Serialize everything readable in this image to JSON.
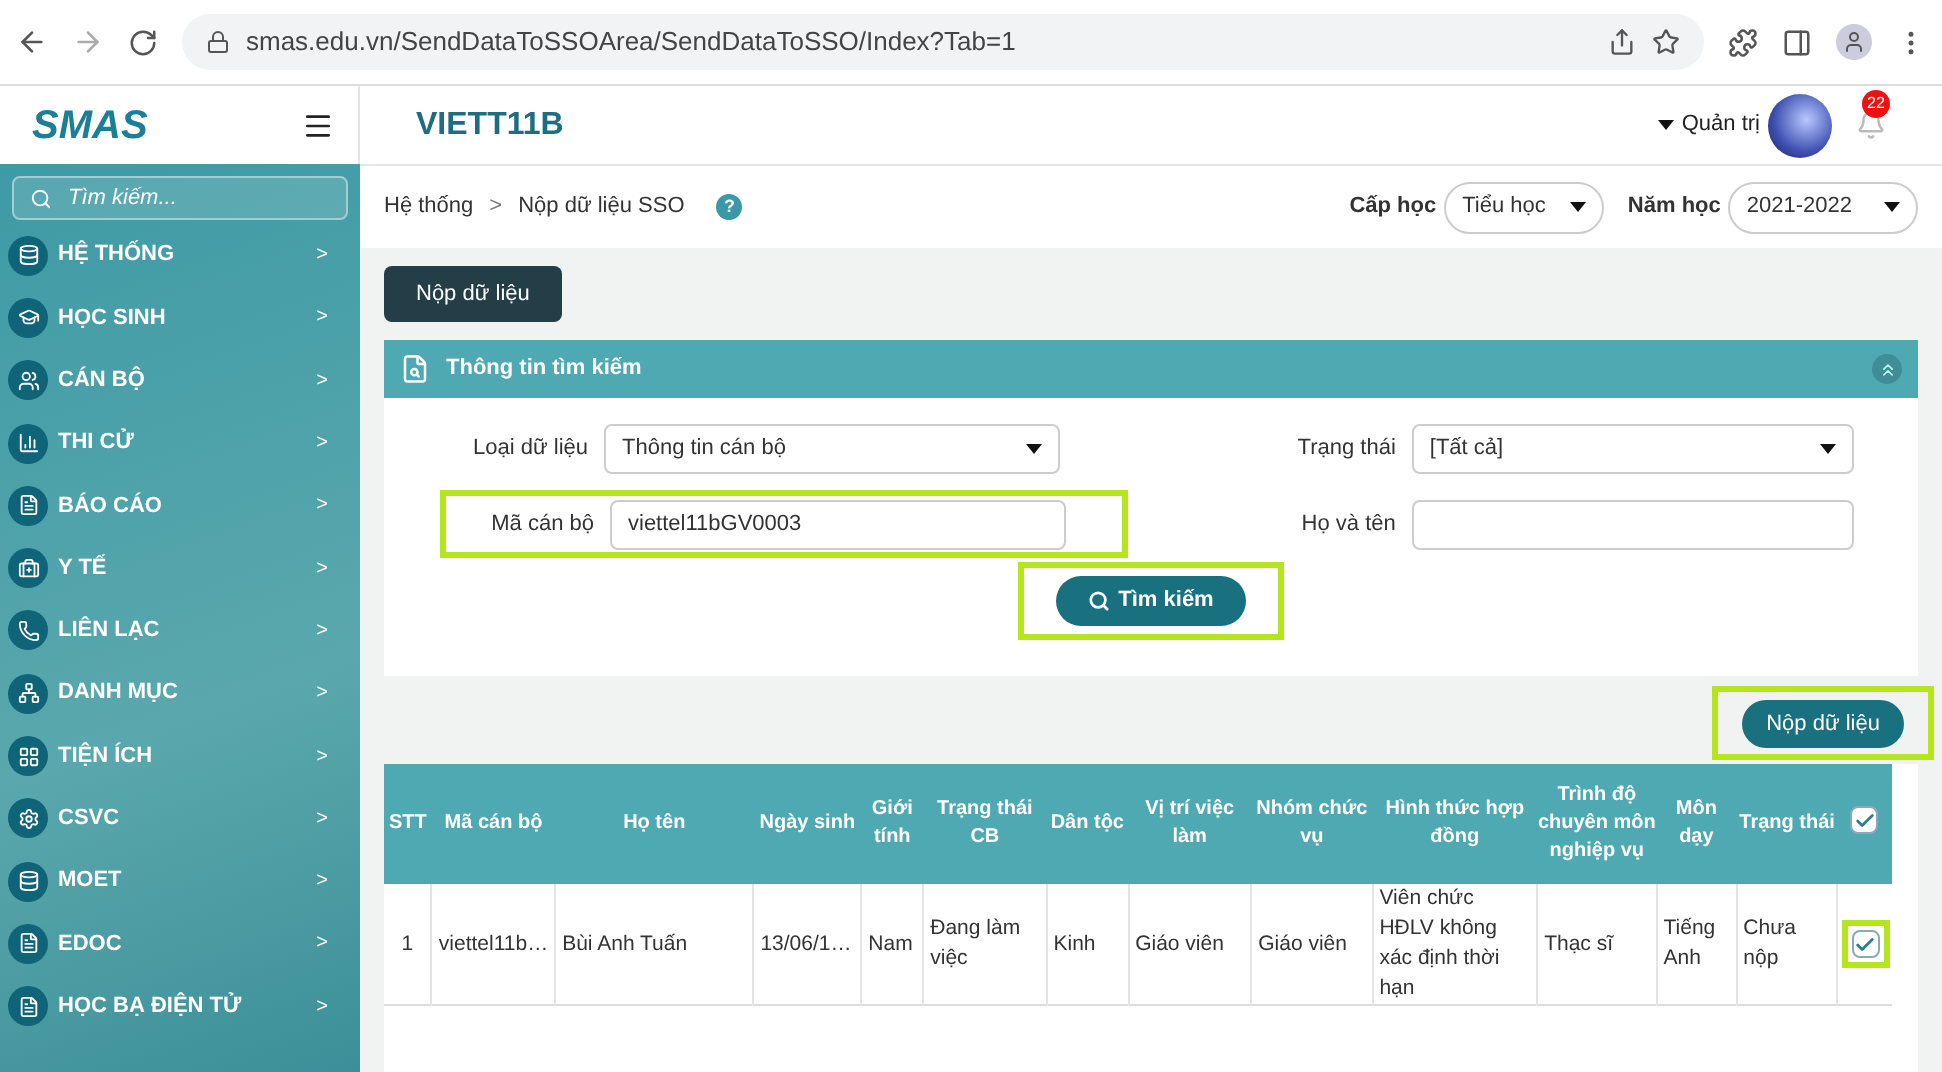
{
  "browser": {
    "url": "smas.edu.vn/SendDataToSSOArea/SendDataToSSO/Index?Tab=1"
  },
  "header": {
    "logo": "SMAS",
    "school": "VIETT11B",
    "user": "Quản trị",
    "notifications": "22"
  },
  "sidebar": {
    "search_placeholder": "Tìm kiếm...",
    "items": [
      {
        "label": "HỆ THỐNG",
        "chevron": ">"
      },
      {
        "label": "HỌC SINH",
        "chevron": ">"
      },
      {
        "label": "CÁN BỘ",
        "chevron": ">"
      },
      {
        "label": "THI CỬ",
        "chevron": ">"
      },
      {
        "label": "BÁO CÁO",
        "chevron": ">"
      },
      {
        "label": "Y TẾ",
        "chevron": ">"
      },
      {
        "label": "LIÊN LẠC",
        "chevron": ">"
      },
      {
        "label": "DANH MỤC",
        "chevron": ">"
      },
      {
        "label": "TIỆN ÍCH",
        "chevron": ">"
      },
      {
        "label": "CSVC",
        "chevron": ">"
      },
      {
        "label": "MOET",
        "chevron": ">"
      },
      {
        "label": "EDOC",
        "chevron": ">"
      },
      {
        "label": "HỌC BẠ ĐIỆN TỬ",
        "chevron": ">"
      }
    ]
  },
  "breadcrumb": {
    "items": [
      "Hệ thống",
      "Nộp dữ liệu SSO"
    ],
    "separator": ">",
    "help": "?"
  },
  "filters": {
    "level_label": "Cấp học",
    "level_value": "Tiểu học",
    "year_label": "Năm học",
    "year_value": "2021-2022"
  },
  "top_button": "Nộp dữ liệu",
  "search_panel": {
    "title": "Thông tin tìm kiếm",
    "fields": [
      {
        "label": "Loại dữ liệu",
        "kind": "select",
        "value": "Thông tin cán bộ",
        "highlighted": false
      },
      {
        "label": "Trạng thái",
        "kind": "select",
        "value": "[Tất cả]",
        "highlighted": false
      },
      {
        "label": "Mã cán bộ",
        "kind": "text",
        "value": "viettel11bGV0003",
        "highlighted": true
      },
      {
        "label": "Họ và tên",
        "kind": "text",
        "highlighted": false
      }
    ],
    "search_button": "Tìm kiếm",
    "search_highlighted": true
  },
  "submit_button": {
    "label": "Nộp dữ liệu",
    "highlighted": true
  },
  "table": {
    "columns": [
      "STT",
      "Mã cán bộ",
      "Họ tên",
      "Ngày sinh",
      "Giới tính",
      "Trạng thái CB",
      "Dân tộc",
      "Vị trí việc làm",
      "Nhóm chức vụ",
      "Hình thức hợp đồng",
      "Trình độ chuyên môn nghiệp vụ",
      "Môn dạy",
      "Trạng thái"
    ],
    "header_checked": true,
    "rows": [
      {
        "cells": [
          "1",
          "viettel11b…",
          "Bùi Anh Tuấn",
          "13/06/1…",
          "Nam",
          "Đang làm việc",
          "Kinh",
          "Giáo viên",
          "Giáo viên",
          "Viên chức HĐLV không xác định thời hạn",
          "Thạc sĩ",
          "Tiếng Anh",
          "Chưa nộp"
        ],
        "checked": true,
        "highlighted": true
      }
    ]
  }
}
